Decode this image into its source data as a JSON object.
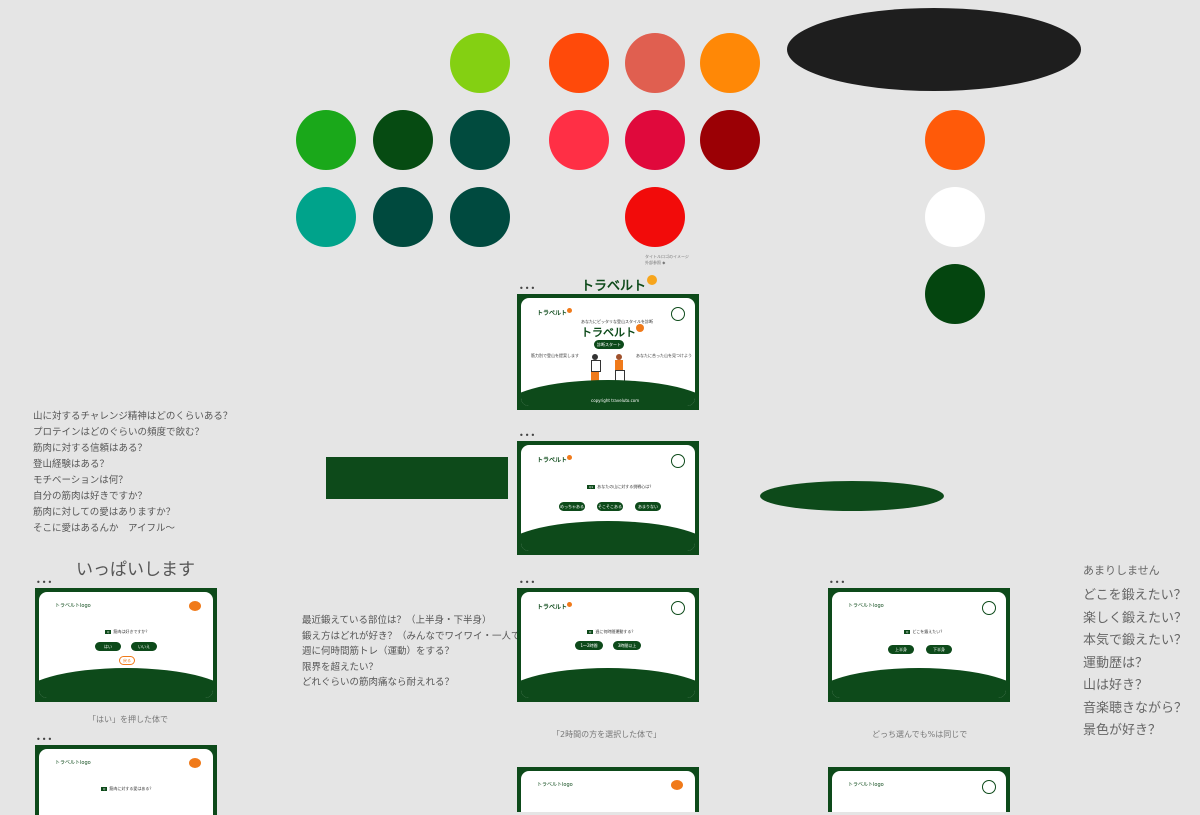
{
  "colors": {
    "background": "#e5e5e5",
    "brand_green": "#0d4a1a",
    "swatches": [
      "#84d012",
      "#ff4a0a",
      "#e05f50",
      "#ff8806",
      "#1aa81a",
      "#064b12",
      "#014b3e",
      "#ff2f45",
      "#e0093c",
      "#9b0005",
      "#00a38b",
      "#004a3e",
      "#004a3f",
      "#f20b0a",
      "#ff5a09",
      "#ffffff",
      "#04450f",
      "#1e1e1e"
    ]
  },
  "logo": {
    "text": "トラベルト"
  },
  "small_note": {
    "line1": "タイトルロゴのイメージ",
    "line2": "外部参照 ◆"
  },
  "left_questions": [
    "山に対するチャレンジ精神はどのくらいある？",
    "プロテインはどのぐらいの頻度で飲む？",
    "筋肉に対する信頼はある？",
    "登山経験はある？",
    "モチベーションは何？",
    "自分の筋肉は好きですか？",
    "筋肉に対しての愛はありますか？",
    "そこに愛はあるんか　アイフル〜"
  ],
  "left_heading": "いっぱいします",
  "middle_questions": [
    "最近鍛えている部位は？（上半身・下半身）",
    "鍛え方はどれが好き？（みんなでワイワイ・一人で黙々）",
    "週に何時間筋トレ（運動）をする？",
    "限界を超えたい？",
    "どれぐらいの筋肉痛なら耐えれる？"
  ],
  "right_heading": "あまりしません",
  "right_questions": [
    "どこを鍛えたい？",
    "楽しく鍛えたい？",
    "本気で鍛えたい？",
    "運動歴は？",
    "山は好き？",
    "音楽聴きながら？",
    "景色が好き？"
  ],
  "captions": {
    "yes_pressed": "「はい」を押した体で",
    "two_hours": "「2時間の方を選択した体で」",
    "either": "どっち選んでも%は同じで"
  },
  "slides": {
    "top": {
      "subtitle": "あなたにピッタリな登山スタイルを診断",
      "title": "トラベルト",
      "start": "診断スタート",
      "left_text": "筋力別で登山を提案します",
      "right_text": "あなたに合った山を見つけよう",
      "footer": "copyright traveluto.com"
    },
    "q1": {
      "tag": "Q1",
      "question": "あなたの山に対する挑戦心は？",
      "options": [
        "めっちゃある",
        "そこそこある",
        "あまりない"
      ]
    },
    "q_yesno": {
      "tag": "Q",
      "question": "筋肉は好きですか？",
      "options": [
        "はい",
        "いいえ"
      ],
      "back": "戻る"
    },
    "q_hours": {
      "tag": "Q",
      "question": "週に何時間運動する？",
      "options": [
        "1〜2時間",
        "3時間以上"
      ]
    },
    "q_body": {
      "tag": "Q",
      "question": "どこを鍛えたい？",
      "options": [
        "上半身",
        "下半身"
      ]
    },
    "q_love": {
      "tag": "Q",
      "question": "筋肉に対する愛はある？"
    },
    "brand_small": "トラベルトlogo"
  },
  "ellipsis": "•••"
}
